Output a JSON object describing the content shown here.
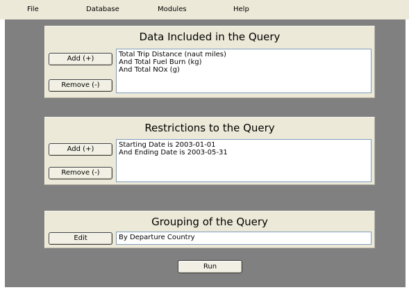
{
  "menu": {
    "file": "File",
    "database": "Database",
    "modules": "Modules",
    "help": "Help"
  },
  "data_panel": {
    "title": "Data Included in the Query",
    "add_label": "Add (+)",
    "remove_label": "Remove (-)",
    "items": [
      "Total Trip Distance (naut miles)",
      "And Total Fuel Burn (kg)",
      "And Total NOx (g)"
    ]
  },
  "restrictions_panel": {
    "title": "Restrictions to the Query",
    "add_label": "Add (+)",
    "remove_label": "Remove (-)",
    "items": [
      "Starting Date is 2003-01-01",
      "And Ending Date is 2003-05-31"
    ]
  },
  "grouping_panel": {
    "title": "Grouping of the Query",
    "edit_label": "Edit",
    "value": "By Departure Country"
  },
  "run_label": "Run"
}
